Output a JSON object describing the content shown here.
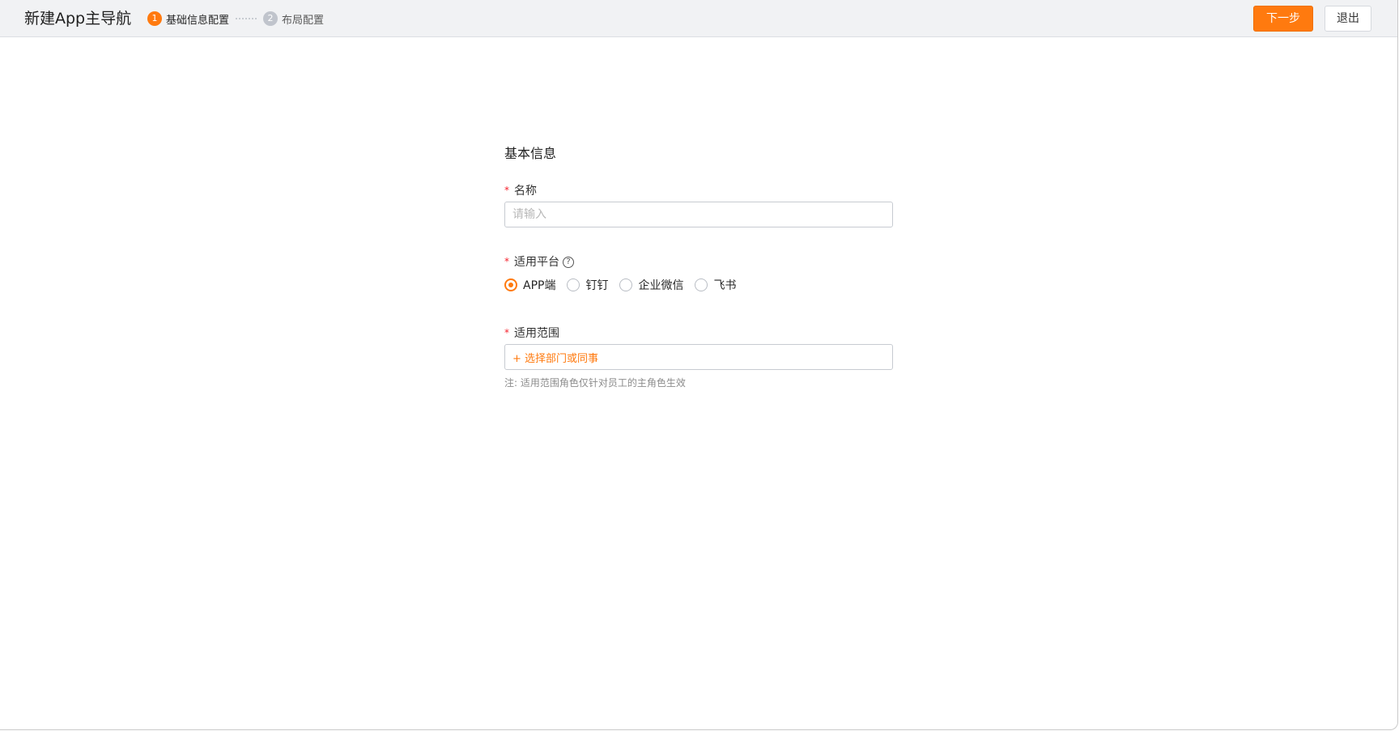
{
  "header": {
    "title": "新建App主导航",
    "steps": [
      {
        "num": "1",
        "label": "基础信息配置",
        "state": "active"
      },
      {
        "num": "2",
        "label": "布局配置",
        "state": "inactive"
      }
    ],
    "next_label": "下一步",
    "exit_label": "退出"
  },
  "form": {
    "section_title": "基本信息",
    "name": {
      "required": "*",
      "label": "名称",
      "value": "",
      "placeholder": "请输入"
    },
    "platform": {
      "required": "*",
      "label": "适用平台",
      "help_icon": "question-circle-icon",
      "options": [
        {
          "label": "APP端",
          "checked": true
        },
        {
          "label": "钉钉",
          "checked": false
        },
        {
          "label": "企业微信",
          "checked": false
        },
        {
          "label": "飞书",
          "checked": false
        }
      ]
    },
    "scope": {
      "required": "*",
      "label": "适用范围",
      "add_label": "+ 选择部门或同事",
      "note": "注: 适用范围角色仅针对员工的主角色生效"
    }
  },
  "colors": {
    "accent": "#ff7a0f",
    "required": "#f5222d",
    "header_bg": "#f1f2f4"
  }
}
